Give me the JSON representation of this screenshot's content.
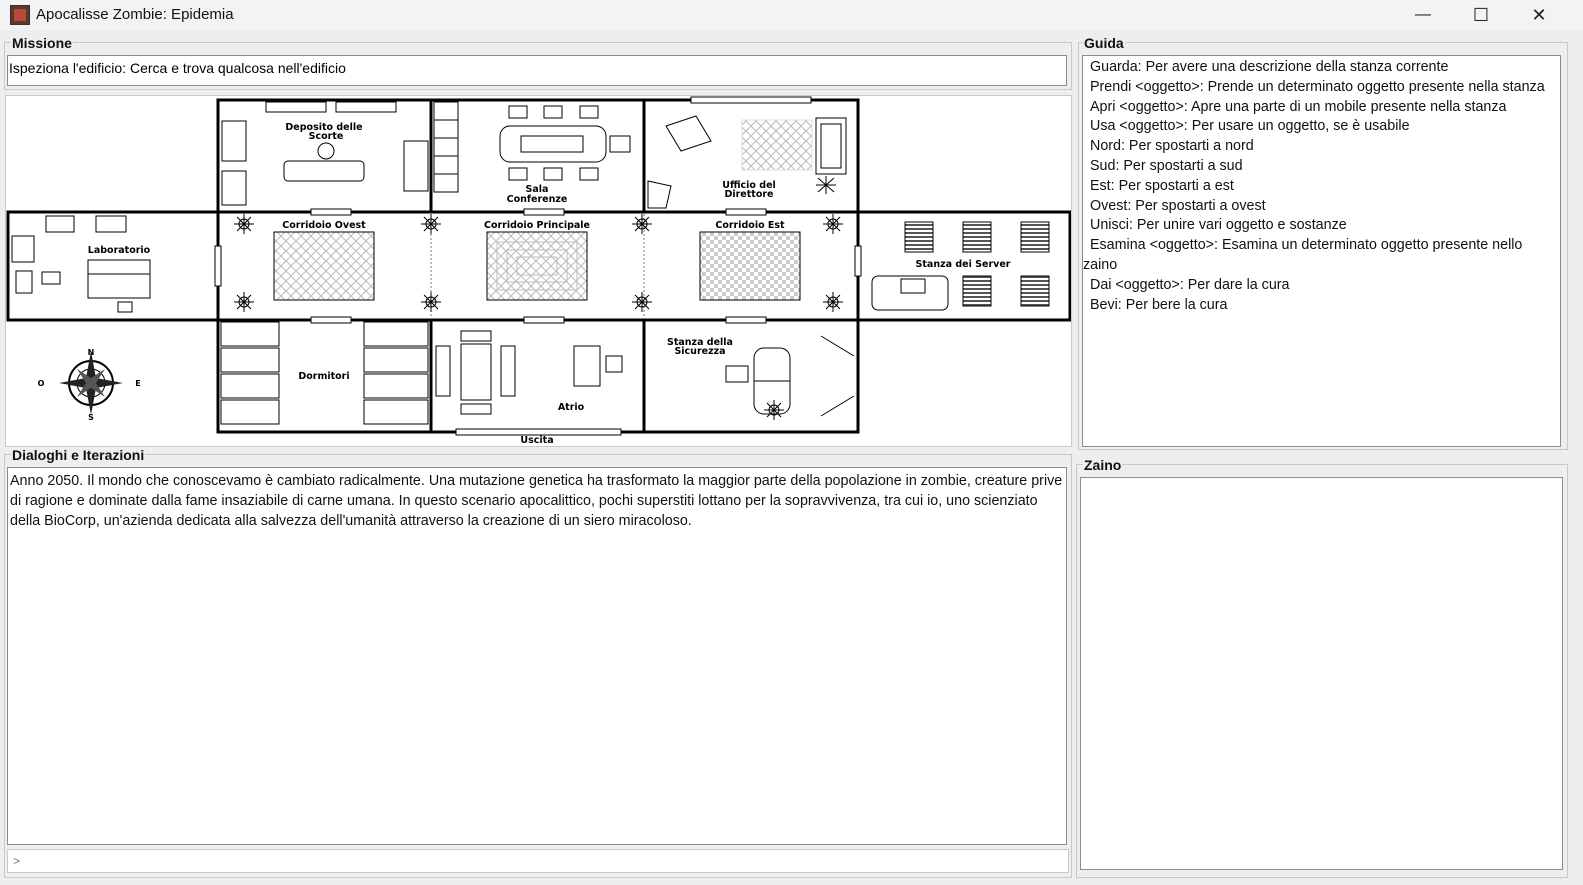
{
  "window": {
    "title": "Apocalisse Zombie: Epidemia",
    "minimize_glyph": "—",
    "maximize_glyph": "☐",
    "close_glyph": "✕"
  },
  "mission": {
    "label": "Missione",
    "text": "Ispeziona l'edificio: Cerca e trova qualcosa nell'edificio"
  },
  "map": {
    "rooms": {
      "deposito_1": "Deposito delle",
      "deposito_2": "Scorte",
      "sala_1": "Sala",
      "sala_2": "Conferenze",
      "ufficio_1": "Ufficio del",
      "ufficio_2": "Direttore",
      "laboratorio": "Laboratorio",
      "corridoio_ovest": "Corridoio Ovest",
      "corridoio_principale": "Corridoio Principale",
      "corridoio_est": "Corridoio Est",
      "server": "Stanza dei Server",
      "dormitori": "Dormitori",
      "atrio": "Atrio",
      "sicurezza_1": "Stanza della",
      "sicurezza_2": "Sicurezza",
      "uscita": "Uscita"
    },
    "compass": {
      "n": "N",
      "s": "S",
      "e": "E",
      "o": "O"
    }
  },
  "guide": {
    "label": "Guida",
    "lines": [
      "Guarda: Per avere una descrizione della stanza corrente",
      "Prendi <oggetto>: Prende un determinato oggetto presente nella stanza",
      "Apri <oggetto>: Apre una parte di un mobile presente nella stanza",
      "Usa <oggetto>: Per usare un oggetto, se è usabile",
      "Nord: Per spostarti a nord",
      "Sud: Per spostarti a sud",
      "Est: Per spostarti a est",
      "Ovest: Per spostarti a ovest",
      "Unisci: Per unire vari oggetto e sostanze",
      "Esamina <oggetto>: Esamina un determinato oggetto presente nello",
      "zaino",
      "Dai <oggetto>: Per dare la cura",
      "Bevi: Per bere la cura"
    ]
  },
  "dialog": {
    "label": "Dialoghi e Iterazioni",
    "text": "Anno 2050. Il mondo che conoscevamo è cambiato radicalmente. Una mutazione genetica ha trasformato la maggior parte della popolazione in zombie, creature prive di ragione e dominate dalla fame insaziabile di carne umana. In questo scenario apocalittico, pochi superstiti lottano per la sopravvivenza, tra cui io, uno scienziato della BioCorp, un'azienda dedicata alla salvezza dell'umanità attraverso la creazione di un siero miracoloso."
  },
  "input": {
    "placeholder": ">"
  },
  "inventory": {
    "label": "Zaino"
  }
}
